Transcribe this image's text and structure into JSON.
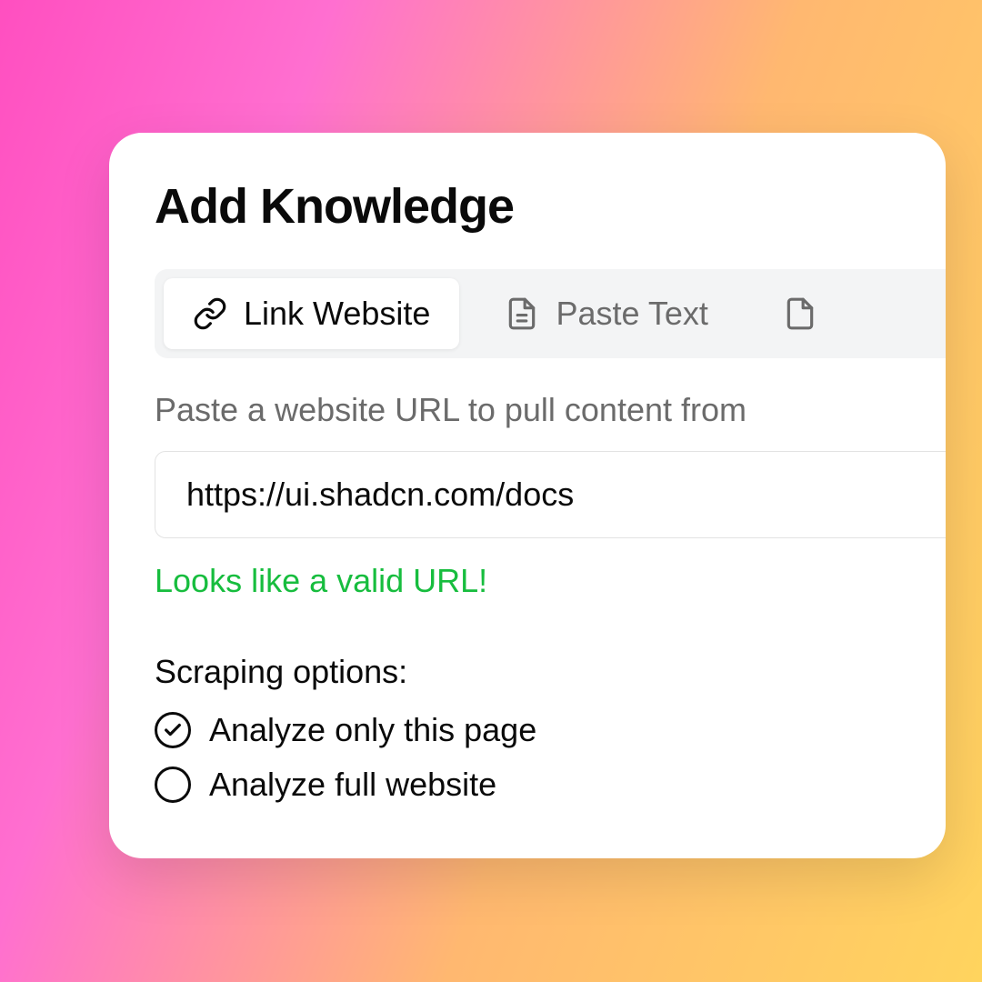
{
  "header": {
    "title": "Add Knowledge"
  },
  "tabs": {
    "link_website": "Link Website",
    "paste_text": "Paste Text"
  },
  "form": {
    "helper_text": "Paste a website URL to pull content from",
    "url_value": "https://ui.shadcn.com/docs",
    "validation_message": "Looks like a valid URL!"
  },
  "options": {
    "label": "Scraping options:",
    "only_this_page": "Analyze only this page",
    "full_website": "Analyze full website"
  }
}
